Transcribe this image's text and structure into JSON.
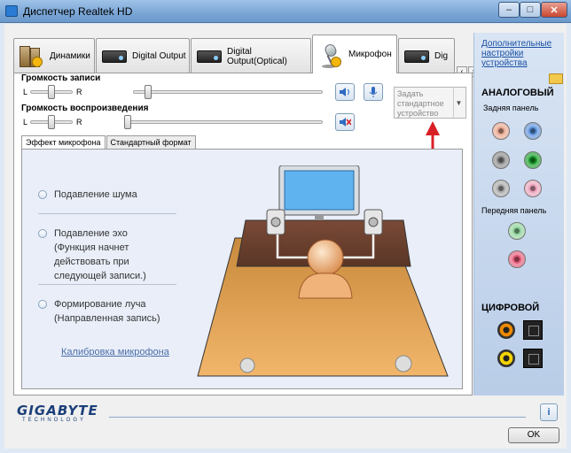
{
  "window": {
    "title": "Диспетчер Realtek HD",
    "minimize": "–",
    "maximize": "□",
    "close": "✕"
  },
  "tabs": [
    {
      "label": "Динамики",
      "icon": "speaker-icon"
    },
    {
      "label": "Digital Output",
      "icon": "digital-output-icon"
    },
    {
      "label": "Digital Output(Optical)",
      "icon": "optical-output-icon"
    },
    {
      "label": "Микрофон",
      "icon": "microphone-icon"
    },
    {
      "label": "Dig",
      "icon": "digital-output-icon"
    }
  ],
  "tab_scroll": {
    "left": "‹",
    "right": "›"
  },
  "recording": {
    "label": "Громкость записи",
    "l": "L",
    "r": "R",
    "balance": 0.5,
    "volume": 0.05
  },
  "playback": {
    "label": "Громкость воспроизведения",
    "l": "L",
    "r": "R",
    "balance": 0.5,
    "volume": 0.0
  },
  "set_default": {
    "label": "Задать стандартное устройство",
    "arrow": "▼"
  },
  "subtabs": [
    "Эффект микрофона",
    "Стандартный формат"
  ],
  "effects": {
    "noise": "Подавление шума",
    "echo_1": "Подавление эхо",
    "echo_2": "(Функция начнет",
    "echo_3": "действовать при",
    "echo_4": "следующей записи.)",
    "beam_1": "Формирование луча",
    "beam_2": "(Направленная запись)",
    "calibrate": "Калибровка микрофона"
  },
  "right_panel": {
    "advanced_link": "Дополнительные настройки устройства",
    "analog_title": "АНАЛОГОВЫЙ",
    "rear_panel": "Задняя панель",
    "front_panel": "Передняя панель",
    "digital_title": "ЦИФРОВОЙ",
    "rear_jacks": [
      "#e8a78f",
      "#5a8fd9",
      "#8a8a8a",
      "#1a9a2a",
      "#a8a8a8",
      "#e8a0b8"
    ],
    "front_jacks": [
      "#8fd19a",
      "#e25a78"
    ]
  },
  "bottom": {
    "logo": "GIGABYTE",
    "logo_sub": "TECHNOLOGY",
    "info": "i",
    "ok": "OK"
  },
  "colors": {
    "accent_red": "#d81f26",
    "title_bar": "#7aa6d6",
    "link": "#1a4fa3"
  }
}
